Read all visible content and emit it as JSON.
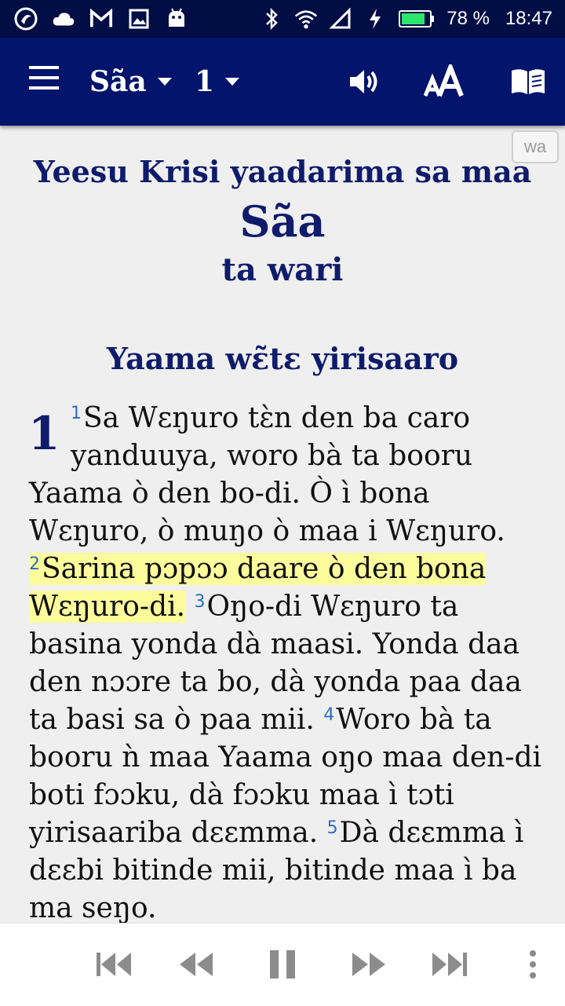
{
  "status_bar": {
    "battery": "78 %",
    "time": "18:47",
    "icons": [
      "app-icon",
      "cloud-icon",
      "gmail-icon",
      "image-icon",
      "android-icon",
      "bluetooth-icon",
      "wifi-icon",
      "signal-icon",
      "charging-icon",
      "battery-icon"
    ]
  },
  "toolbar": {
    "book": "Sãa",
    "chapter": "1",
    "actions": [
      "audio-icon",
      "text-size-icon",
      "book-icon"
    ]
  },
  "content": {
    "lang_badge": "wa",
    "title_line1": "Yeesu Krisi yaadarima sa maa",
    "title_line2": "Sãa",
    "title_line3": "ta wari",
    "section_heading": "Yaama wɛ̃tɛ yirisaaro",
    "chapter_number": "1",
    "lines": [
      {
        "v": "1",
        "text": "Sa Wɛŋuro tɛ̀n den ba caro"
      },
      {
        "text": "yanduuya, woro bà ta booru"
      },
      {
        "text": "Yaama ò den bo-di. Ò ì bona"
      },
      {
        "text": "Wɛŋuro, ò muŋo ò maa i Wɛŋuro."
      },
      {
        "v": "2",
        "text": "Sarina pɔpɔɔ daare ò den bona",
        "hl": true
      },
      {
        "text": "Wɛŋuro-di.",
        "hl": true,
        "v2": "3",
        "text2": "Oŋo-di Wɛŋuro ta"
      },
      {
        "text": "basina yonda dà maasi. Yonda daa"
      },
      {
        "text": "den nɔɔre ta bo, dà yonda paa daa"
      },
      {
        "text": "ta basi sa ò paa mii.",
        "v2": "4",
        "text2": "Woro bà ta"
      },
      {
        "text": "booru ǹ maa Yaama oŋo maa den-di"
      },
      {
        "text": "boti fɔɔku, dà fɔɔku maa ì tɔti"
      },
      {
        "text": "yirisaariba dɛɛmma.",
        "v2": "5",
        "text2": "Dà dɛɛmma ì"
      },
      {
        "text": "dɛɛbi bitinde mii, bitinde maa ì ba"
      },
      {
        "text": "ma seŋo."
      }
    ]
  },
  "player": {
    "buttons": [
      "skip-previous-icon",
      "rewind-icon",
      "pause-icon",
      "fast-forward-icon",
      "skip-next-icon",
      "more-vert-icon"
    ]
  }
}
